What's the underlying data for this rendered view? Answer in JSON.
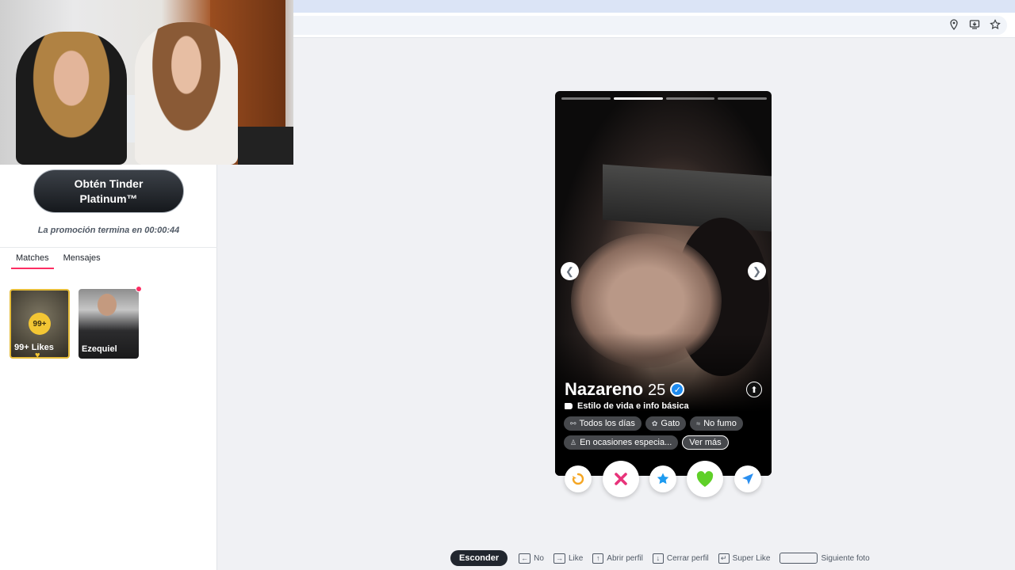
{
  "sidebar": {
    "platinum_button": "Obtén Tinder Platinum™",
    "promo_text": "La promoción termina en 00:00:44",
    "tabs": [
      "Matches",
      "Mensajes"
    ],
    "likes_badge": "99+",
    "likes_label": "99+ Likes",
    "match_name": "Ezequiel"
  },
  "profile": {
    "name": "Nazareno",
    "age": "25",
    "section_label": "Estilo de vida e info básica",
    "chips": [
      "Todos los días",
      "Gato",
      "No fumo",
      "En ocasiones especia...",
      "Ver más"
    ],
    "photo_count": 4,
    "active_photo": 2
  },
  "shortcuts": {
    "hide_button": "Esconder",
    "items": [
      "No",
      "Like",
      "Abrir perfil",
      "Cerrar perfil",
      "Super Like",
      "Siguiente foto"
    ]
  },
  "colors": {
    "brand": "#fd2d63",
    "gold": "#f3c634",
    "verified": "#1f8cf0"
  }
}
